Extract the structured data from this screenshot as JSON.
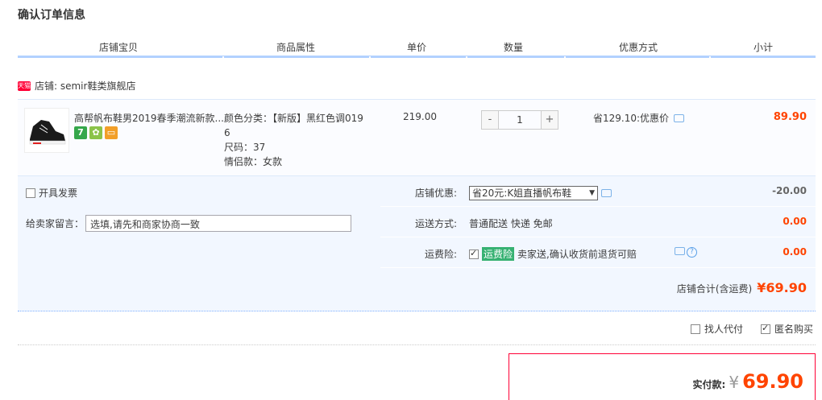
{
  "page_title": "确认订单信息",
  "columns": [
    "店铺宝贝",
    "商品属性",
    "单价",
    "数量",
    "优惠方式",
    "小计"
  ],
  "shop": {
    "badge": "天猫",
    "label": "店铺: semir鞋类旗舰店"
  },
  "item": {
    "title": "高帮帆布鞋男2019春季潮流新款...",
    "attrs": [
      "颜色分类：【新版】黑红色调019",
      "6",
      "尺码：37",
      "情侣款：女款"
    ],
    "price": "219.00",
    "qty": "1",
    "qty_minus": "-",
    "qty_plus": "+",
    "discount": "省129.10:优惠价",
    "subtotal": "89.90",
    "badges": {
      "seven": "7"
    }
  },
  "invoice_label": "开具发票",
  "memo": {
    "label": "给卖家留言：",
    "placeholder": "选填,请先和商家协商一致"
  },
  "shop_discount": {
    "label": "店铺优惠:",
    "selected": "省20元:K姐直播帆布鞋",
    "amount": "-20.00"
  },
  "shipping": {
    "label": "运送方式:",
    "value": "普通配送 快递 免邮",
    "amount": "0.00"
  },
  "insurance": {
    "label": "运费险:",
    "tag": "运费险",
    "value": "卖家送,确认收货前退货可赔",
    "amount": "0.00"
  },
  "shop_total": {
    "label": "店铺合计(含运费)",
    "amount": "¥69.90"
  },
  "options": {
    "proxy_pay": "找人代付",
    "anonymous": "匿名购买"
  },
  "payment": {
    "label": "实付款:",
    "yen": "¥",
    "amount": "69.90"
  }
}
